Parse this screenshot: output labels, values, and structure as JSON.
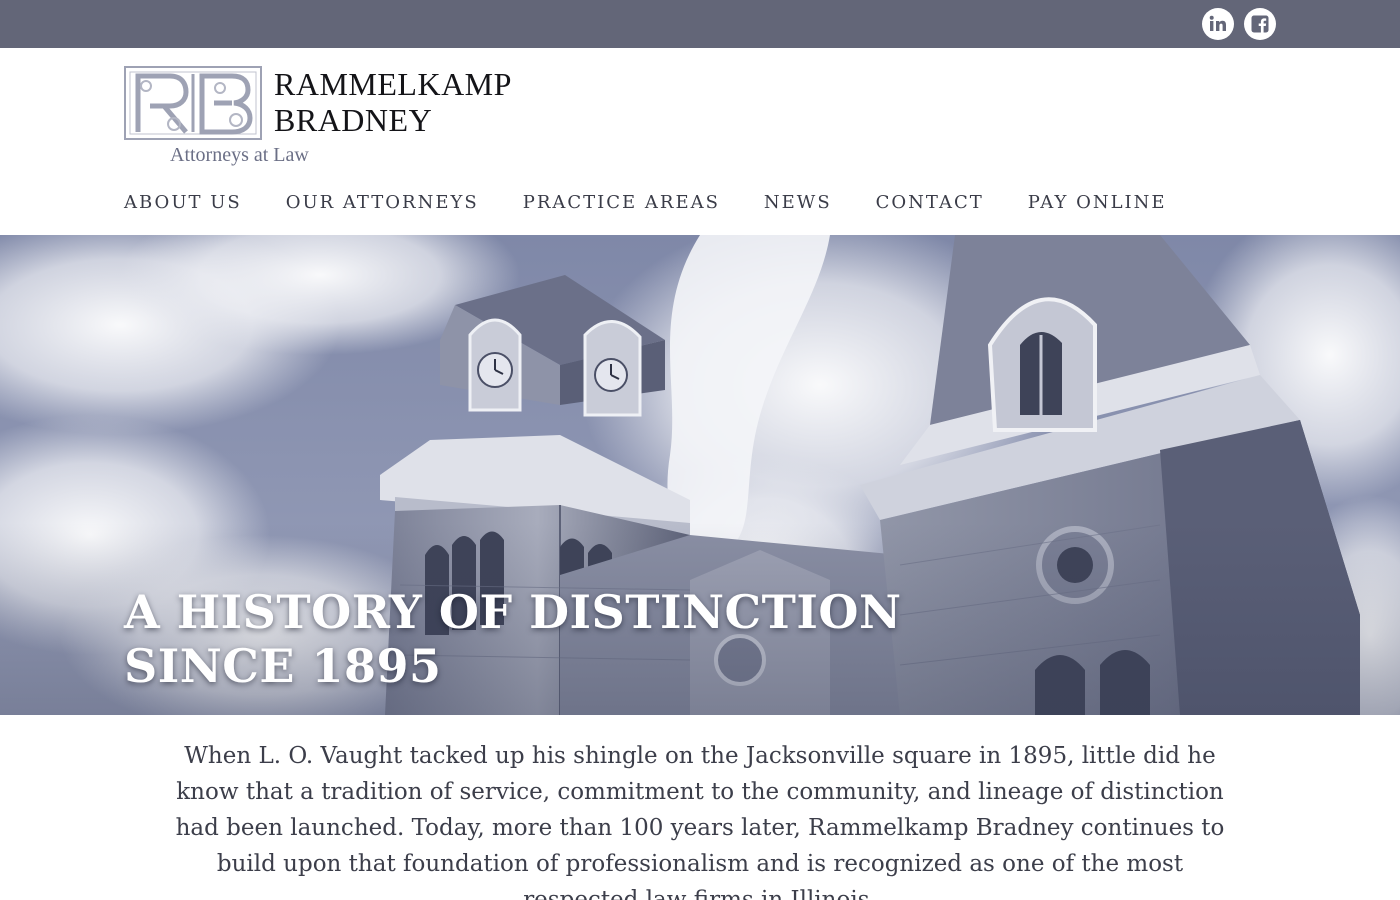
{
  "social": {
    "linkedin_icon": "linkedin-icon",
    "facebook_icon": "facebook-icon"
  },
  "brand": {
    "monogram": "RB",
    "name_line1": "RAMMELKAMP",
    "name_line2": "BRADNEY",
    "tagline": "Attorneys at Law"
  },
  "nav": {
    "items": [
      {
        "label": "ABOUT US"
      },
      {
        "label": "OUR ATTORNEYS"
      },
      {
        "label": "PRACTICE AREAS"
      },
      {
        "label": "NEWS"
      },
      {
        "label": "CONTACT"
      },
      {
        "label": "PAY ONLINE"
      }
    ]
  },
  "hero": {
    "title_line1": "A HISTORY OF DISTINCTION",
    "title_line2": "SINCE 1895"
  },
  "intro": {
    "text": "When L. O. Vaught tacked up his shingle on the Jacksonville square in 1895, little did he know that a tradition of service, commitment to the community, and lineage of distinction had been launched. Today, more than 100 years later, Rammelkamp Bradney continues to build upon that foundation of professionalism and is recognized as one of the most respected law firms in Illinois."
  },
  "colors": {
    "topbar": "#636678",
    "nav_text": "#3a3c48",
    "tagline": "#6b6f86"
  }
}
